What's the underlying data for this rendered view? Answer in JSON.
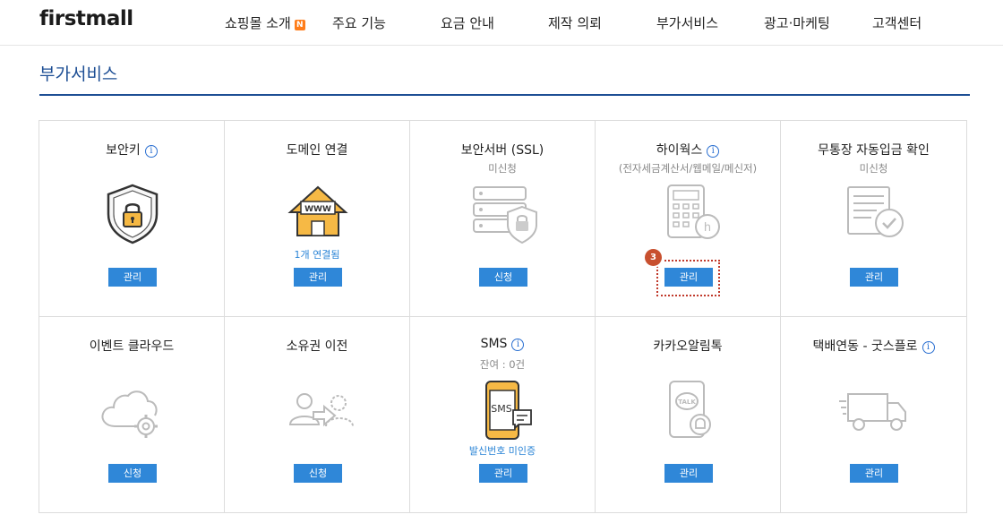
{
  "header": {
    "logo": "firstmall",
    "nav": [
      {
        "label": "쇼핑몰 소개",
        "badge": "N"
      },
      {
        "label": "주요 기능"
      },
      {
        "label": "요금 안내"
      },
      {
        "label": "제작 의뢰"
      },
      {
        "label": "부가서비스"
      },
      {
        "label": "광고·마케팅"
      },
      {
        "label": "고객센터"
      }
    ]
  },
  "page": {
    "title": "부가서비스"
  },
  "services": [
    {
      "title": "보안키",
      "info": true,
      "sub": "",
      "status": "",
      "button": "관리",
      "icon": "shield-lock-icon"
    },
    {
      "title": "도메인 연결",
      "info": false,
      "sub": "",
      "status": "1개 연결됨",
      "button": "관리",
      "icon": "www-house-icon"
    },
    {
      "title": "보안서버 (SSL)",
      "info": false,
      "sub": "미신청",
      "status": "",
      "button": "신청",
      "icon": "server-lock-icon"
    },
    {
      "title": "하이웍스",
      "info": true,
      "sub": "(전자세금계산서/웹메일/메신저)",
      "status": "",
      "button": "관리",
      "icon": "calculator-icon"
    },
    {
      "title": "무통장 자동입금 확인",
      "info": false,
      "sub": "미신청",
      "status": "",
      "button": "관리",
      "icon": "bank-check-icon"
    },
    {
      "title": "이벤트 클라우드",
      "info": false,
      "sub": "",
      "status": "",
      "button": "신청",
      "icon": "cloud-gear-icon"
    },
    {
      "title": "소유권 이전",
      "info": false,
      "sub": "",
      "status": "",
      "button": "신청",
      "icon": "user-transfer-icon"
    },
    {
      "title": "SMS",
      "info": true,
      "sub": "잔여 : 0건",
      "status": "발신번호 미인증",
      "button": "관리",
      "icon": "sms-phone-icon"
    },
    {
      "title": "카카오알림톡",
      "info": false,
      "sub": "",
      "status": "",
      "button": "관리",
      "icon": "kakao-talk-icon"
    },
    {
      "title": "택배연동 - 굿스플로",
      "info": true,
      "sub": "",
      "status": "",
      "button": "관리",
      "icon": "delivery-truck-icon"
    }
  ],
  "annotation": {
    "step": "3"
  },
  "colors": {
    "accent": "#1d4e94",
    "button": "#2f87d8",
    "badge": "#ff7d1a",
    "step": "#c8502f"
  }
}
